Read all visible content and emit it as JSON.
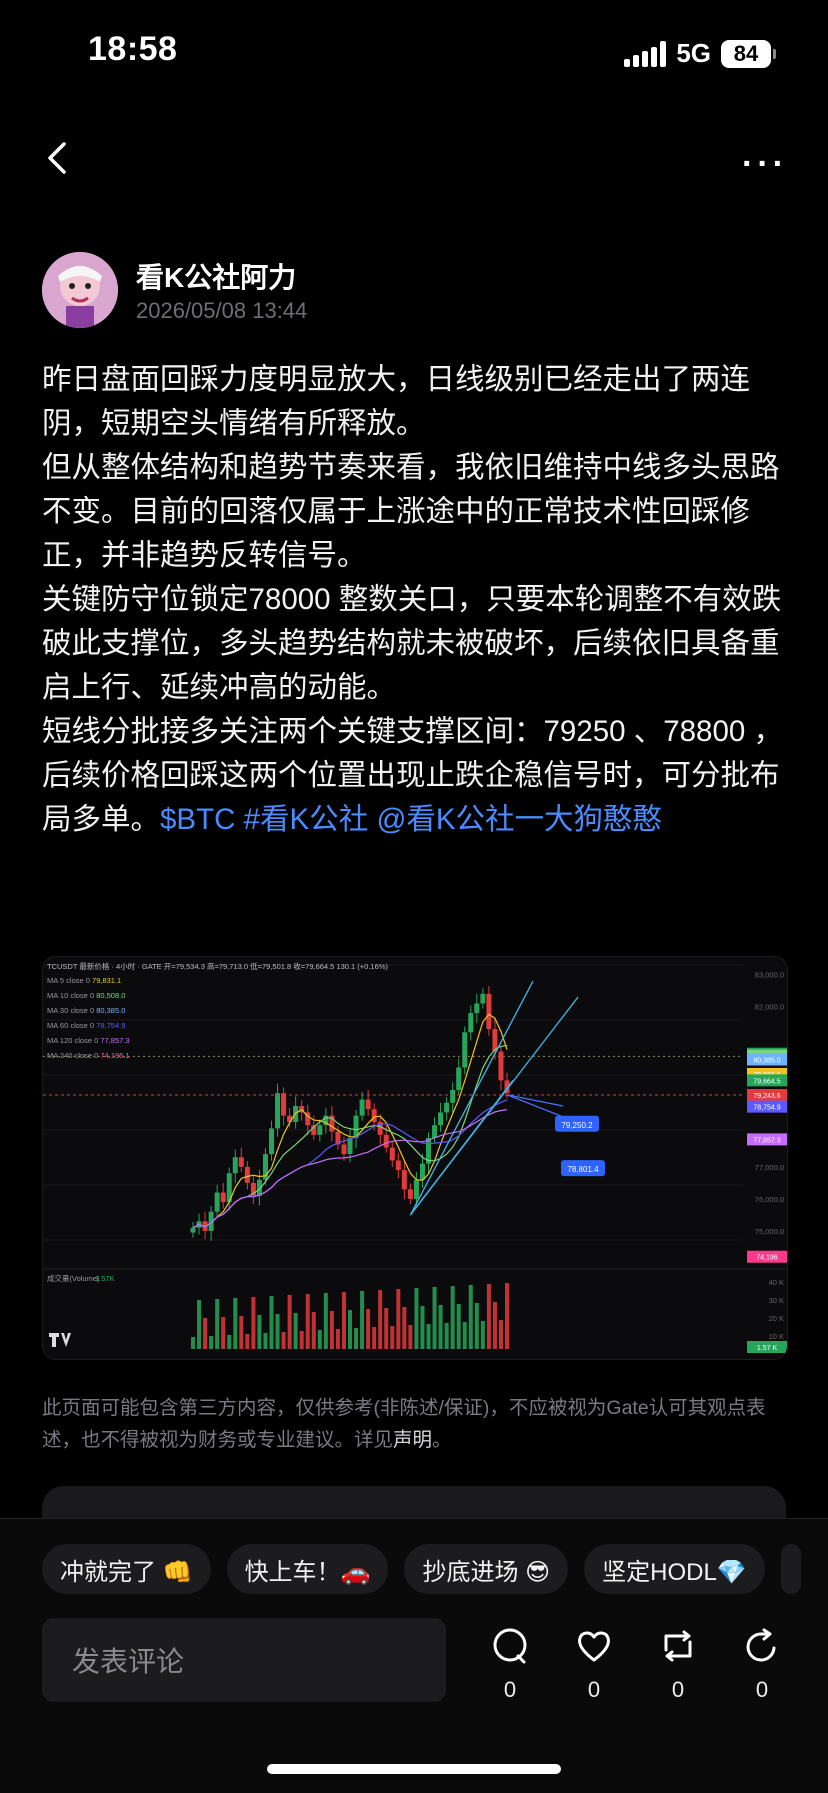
{
  "status_bar": {
    "time": "18:58",
    "network": "5G",
    "battery": "84"
  },
  "author": {
    "name": "看K公社阿力",
    "timestamp": "2026/05/08 13:44"
  },
  "post": {
    "paragraphs": [
      "昨日盘面回踩力度明显放大，日线级别已经走出了两连阴，短期空头情绪有所释放。",
      "但从整体结构和趋势节奏来看，我依旧维持中线多头思路不变。目前的回落仅属于上涨途中的正常技术性回踩修正，并非趋势反转信号。",
      "关键防守位锁定78000 整数关口，只要本轮调整不有效跌破此支撑位，多头趋势结构就未被破坏，后续依旧具备重启上行、延续冲高的动能。"
    ],
    "last_paragraph_text": "短线分批接多关注两个关键支撑区间：79250 、78800 ，后续价格回踩这两个位置出现止跌企稳信号时，可分批布局多单。",
    "tags": [
      "$BTC",
      "#看K公社",
      "@看K公社一大狗憨憨"
    ]
  },
  "chart_data": {
    "type": "line",
    "header": "TCUSDT 最新价格 · 4小时 · GATE",
    "ohlc": "开=79,534.3  高=79,713.0  低=79,501.8  收=79,664.5  130.1 (+0.16%)",
    "ma_legend": [
      {
        "label": "MA 5 close 0",
        "value": "79,831.1",
        "color": "#f0c419"
      },
      {
        "label": "MA 10 close 0",
        "value": "80,508.0",
        "color": "#7bd67b"
      },
      {
        "label": "MA 30 close 0",
        "value": "80,385.0",
        "color": "#6fb3ff"
      },
      {
        "label": "MA 60 close 0",
        "value": "78,754.9",
        "color": "#5a5aff"
      },
      {
        "label": "MA 120 close 0",
        "value": "77,857.3",
        "color": "#c86cff"
      },
      {
        "label": "MA 240 close 0",
        "value": "74,196.1",
        "color": "#ff5aa0"
      }
    ],
    "y_ticks": [
      "83,000.0",
      "82,000.0",
      "77,000.0",
      "76,000.0",
      "75,000.0"
    ],
    "ylim": [
      74000,
      83300
    ],
    "price_tags": [
      {
        "value": "80,531.1",
        "num": 80531,
        "color": "#26a65b"
      },
      {
        "value": "80,508.0",
        "num": 80470,
        "color": "#7bd67b"
      },
      {
        "value": "80,385.0",
        "num": 80350,
        "color": "#6fb3ff"
      },
      {
        "value": "79,831.1",
        "num": 79900,
        "color": "#f0c419"
      },
      {
        "value": "79,664.5",
        "num": 79700,
        "color": "#26a65b"
      },
      {
        "value": "79,243.6",
        "num": 79243,
        "color": "#e23b3b"
      },
      {
        "value": "78,754.9",
        "num": 78880,
        "color": "#5a5aff"
      },
      {
        "value": "77,857.3",
        "num": 77857,
        "color": "#c86cff"
      },
      {
        "value": "74,196",
        "num": 74196,
        "color": "#ff3a8c"
      }
    ],
    "support_labels": [
      {
        "value": "79,250.2",
        "num": 79250
      },
      {
        "value": "78,801.4",
        "num": 78801
      }
    ],
    "volume_label": "成交量(Volume)",
    "volume_value": "1.57K",
    "volume_ticks": [
      "40 K",
      "30 K",
      "20 K",
      "10 K"
    ],
    "volume_tag": "1.57 K",
    "closes": [
      75100,
      75300,
      75000,
      75600,
      76200,
      75900,
      76800,
      77300,
      77000,
      76500,
      76100,
      76600,
      77400,
      78200,
      79300,
      78600,
      78400,
      78900,
      78700,
      78300,
      78000,
      78300,
      78600,
      78100,
      77700,
      77400,
      77900,
      78600,
      79100,
      78800,
      78400,
      78000,
      77600,
      77200,
      76900,
      76300,
      76000,
      76600,
      77100,
      77900,
      78300,
      78700,
      79000,
      79400,
      80100,
      81200,
      81800,
      82100,
      82400,
      81300,
      80600,
      79700,
      79300
    ]
  },
  "disclaimer": {
    "text": "此页面可能包含第三方内容，仅供参考(非陈述/保证)，不应被视为Gate认可其观点表述，也不得被视为财务或专业建议。详见",
    "link": "声明",
    "end": "。"
  },
  "reactions": [
    "冲就完了 👊",
    "快上车！🚗",
    "抄底进场 😎",
    "坚定HODL💎"
  ],
  "comment_placeholder": "发表评论",
  "actions": {
    "comment_count": "0",
    "like_count": "0",
    "repost_count": "0",
    "share_count": "0"
  }
}
